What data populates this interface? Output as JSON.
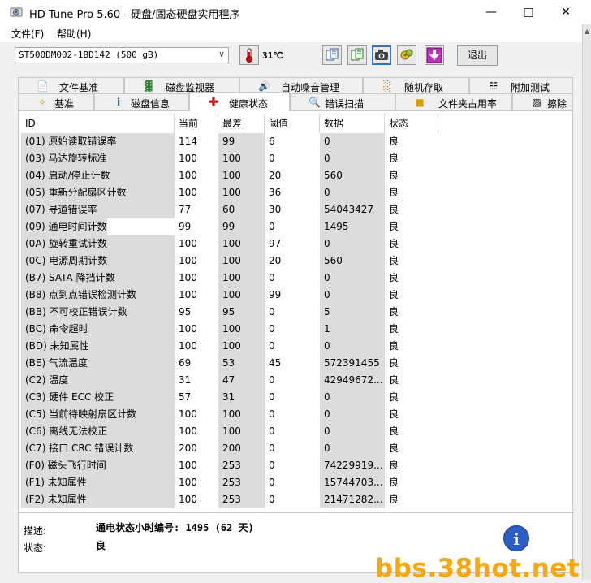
{
  "window": {
    "title": "HD Tune Pro 5.60 - 硬盘/固态硬盘实用程序"
  },
  "menu": [
    {
      "label": "文件(F)"
    },
    {
      "label": "帮助(H)"
    }
  ],
  "toolbar": {
    "drive": "ST500DM002-1BD142 (500 gB)",
    "temperature": "31℃",
    "exit_label": "退出"
  },
  "tabs_row1": [
    {
      "label": "文件基准"
    },
    {
      "label": "磁盘监视器"
    },
    {
      "label": "自动噪音管理"
    },
    {
      "label": "随机存取"
    },
    {
      "label": "附加测试"
    }
  ],
  "tabs_row2": [
    {
      "label": "基准"
    },
    {
      "label": "磁盘信息"
    },
    {
      "label": "健康状态"
    },
    {
      "label": "错误扫描"
    },
    {
      "label": "文件夹占用率"
    },
    {
      "label": "擦除"
    }
  ],
  "table": {
    "headers": [
      "ID",
      "当前",
      "最差",
      "阈值",
      "数据",
      "状态"
    ],
    "rows": [
      [
        "(01) 原始读取错误率",
        "114",
        "99",
        "6",
        "0",
        "良"
      ],
      [
        "(03) 马达旋转标准",
        "100",
        "100",
        "0",
        "0",
        "良"
      ],
      [
        "(04) 启动/停止计数",
        "100",
        "100",
        "20",
        "560",
        "良"
      ],
      [
        "(05) 重新分配扇区计数",
        "100",
        "100",
        "36",
        "0",
        "良"
      ],
      [
        "(07) 寻道错误率",
        "77",
        "60",
        "30",
        "54043427",
        "良"
      ],
      [
        "(09) 通电时间计数",
        "99",
        "99",
        "0",
        "1495",
        "良"
      ],
      [
        "(0A) 旋转重试计数",
        "100",
        "100",
        "97",
        "0",
        "良"
      ],
      [
        "(0C) 电源周期计数",
        "100",
        "100",
        "20",
        "560",
        "良"
      ],
      [
        "(B7) SATA 降挡计数",
        "100",
        "100",
        "0",
        "0",
        "良"
      ],
      [
        "(B8) 点到点错误检测计数",
        "100",
        "100",
        "99",
        "0",
        "良"
      ],
      [
        "(BB) 不可校正错误计数",
        "95",
        "95",
        "0",
        "5",
        "良"
      ],
      [
        "(BC) 命令超时",
        "100",
        "100",
        "0",
        "1",
        "良"
      ],
      [
        "(BD) 未知属性",
        "100",
        "100",
        "0",
        "0",
        "良"
      ],
      [
        "(BE) 气流温度",
        "69",
        "53",
        "45",
        "572391455",
        "良"
      ],
      [
        "(C2) 温度",
        "31",
        "47",
        "0",
        "42949672...",
        "良"
      ],
      [
        "(C3) 硬件 ECC 校正",
        "57",
        "31",
        "0",
        "0",
        "良"
      ],
      [
        "(C5) 当前待映射扇区计数",
        "100",
        "100",
        "0",
        "0",
        "良"
      ],
      [
        "(C6) 离线无法校正",
        "100",
        "100",
        "0",
        "0",
        "良"
      ],
      [
        "(C7) 接口 CRC 错误计数",
        "200",
        "200",
        "0",
        "0",
        "良"
      ],
      [
        "(F0) 磁头飞行时间",
        "100",
        "253",
        "0",
        "74229919...",
        "良"
      ],
      [
        "(F1) 未知属性",
        "100",
        "253",
        "0",
        "15744703...",
        "良"
      ],
      [
        "(F2) 未知属性",
        "100",
        "253",
        "0",
        "21471282...",
        "良"
      ]
    ]
  },
  "footer": {
    "desc_label": "描述:",
    "desc_value": "通电状态小时编号: 1495 (62 天)",
    "status_label": "状态:",
    "status_value": "良"
  },
  "watermark": "bbs.38hot.net"
}
